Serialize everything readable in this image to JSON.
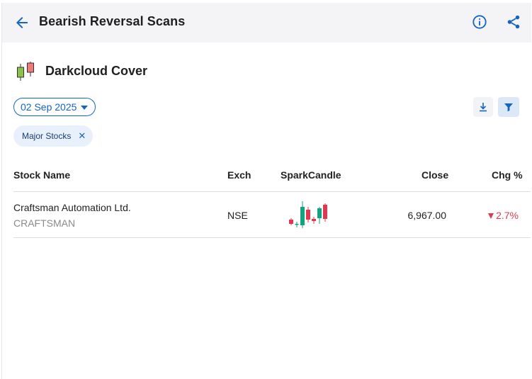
{
  "header": {
    "title": "Bearish Reversal Scans"
  },
  "scan": {
    "name": "Darkcloud Cover"
  },
  "filters": {
    "date": "02 Sep 2025",
    "chips": [
      {
        "label": "Major Stocks"
      }
    ]
  },
  "table": {
    "columns": {
      "stock_name": "Stock Name",
      "exch": "Exch",
      "sparkcandle": "SparkCandle",
      "close": "Close",
      "chg": "Chg %"
    },
    "rows": [
      {
        "name": "Craftsman Automation Ltd.",
        "symbol": "CRAFTSMAN",
        "exch": "NSE",
        "close": "6,967.00",
        "chg": "2.7%",
        "direction": "down"
      }
    ]
  },
  "colors": {
    "accent": "#1565c0",
    "candle_up": "#14a37f",
    "candle_down": "#e0394f"
  }
}
